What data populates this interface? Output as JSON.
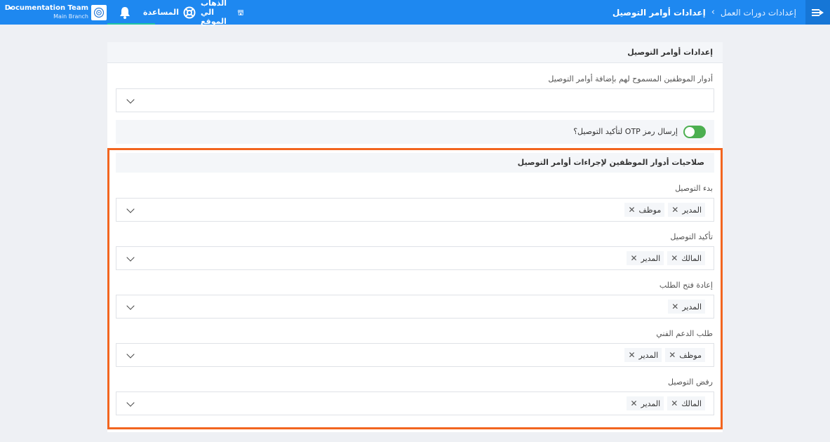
{
  "topbar": {
    "breadcrumb_parent": "إعدادات دورات العمل",
    "breadcrumb_current": "إعدادات أوامر التوصيل",
    "account_name": "Documentation Team",
    "account_branch": "Main Branch",
    "help_label": "المساعدة",
    "site_label": "الذهاب الي الموقع",
    "colors": {
      "bar": "#1e88f0",
      "menu": "#1676d6",
      "active_underline": "#1fc3a5"
    },
    "icons": [
      "menu-arrow-icon",
      "chevron-right-icon",
      "caret-down-icon",
      "org-logo-icon",
      "bell-icon",
      "lifebuoy-icon",
      "storefront-icon"
    ]
  },
  "card": {
    "title": "إعدادات أوامر التوصيل",
    "allowed_roles_label": "أدوار الموظفين المسموح لهم بإضافة أوامر التوصيل",
    "otp_label": "إرسال رمز OTP لتأكيد التوصيل؟",
    "otp_enabled": true,
    "toggle_color": "#4caf50",
    "highlight_color": "#f2651f"
  },
  "permissions": {
    "title": "صلاحيات أدوار الموظفين لإجراءات أوامر التوصيل",
    "fields": [
      {
        "label": "بدء التوصيل",
        "chips": [
          "المدير",
          "موظف"
        ]
      },
      {
        "label": "تأكيد التوصيل",
        "chips": [
          "المالك",
          "المدير"
        ]
      },
      {
        "label": "إعادة فتح الطلب",
        "chips": [
          "المدير"
        ]
      },
      {
        "label": "طلب الدعم الفني",
        "chips": [
          "موظف",
          "المدير"
        ]
      },
      {
        "label": "رفض التوصيل",
        "chips": [
          "المالك",
          "المدير"
        ]
      }
    ]
  }
}
